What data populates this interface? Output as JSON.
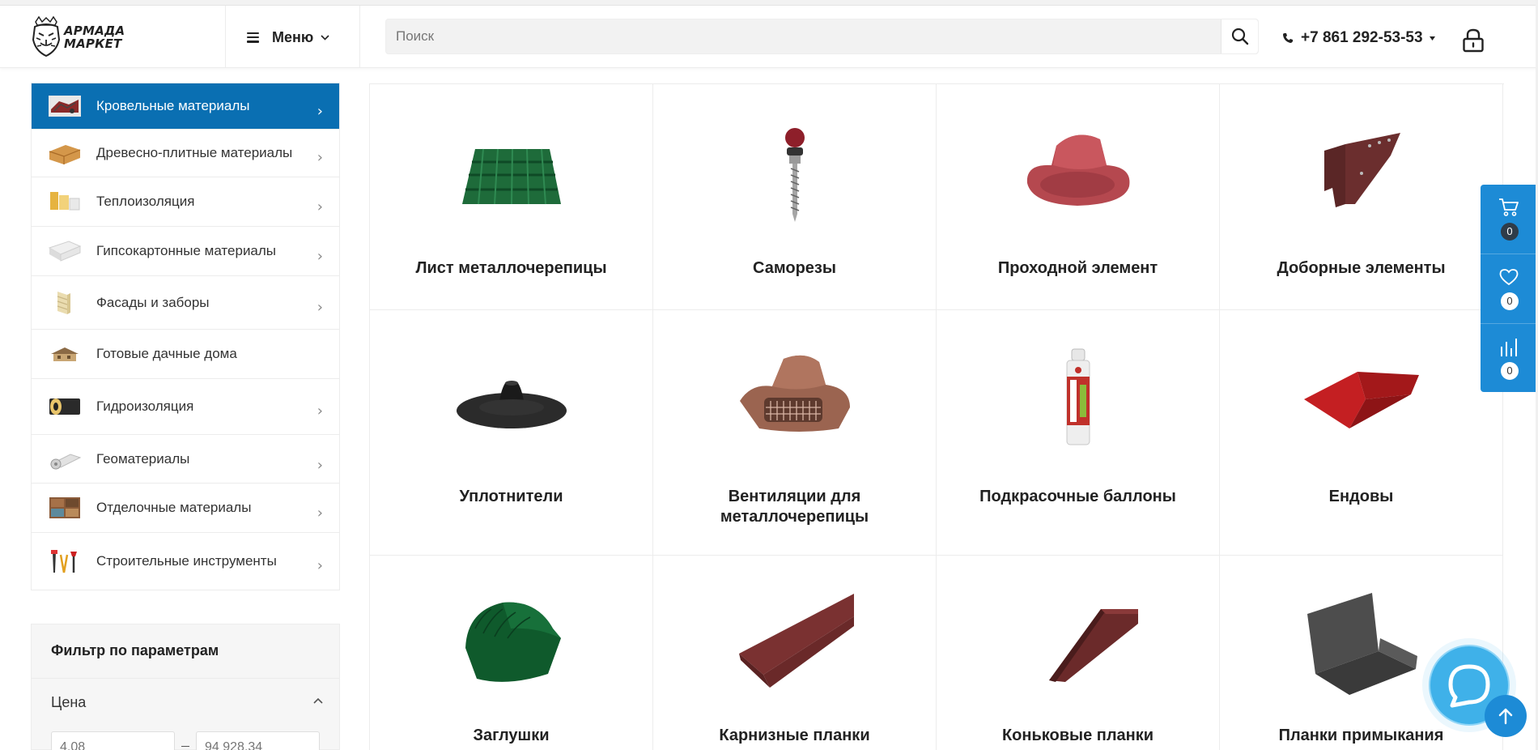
{
  "brand": {
    "logo_line1": "АРМАДА",
    "logo_line2": "МАРКЕТ"
  },
  "header": {
    "menu_label": "Меню",
    "search_placeholder": "Поиск",
    "search_value": "",
    "phone": "+7 861 292-53-53"
  },
  "categories": [
    {
      "label": "Кровельные материалы",
      "has_arrow": true,
      "active": true
    },
    {
      "label": "Древесно-плитные материалы",
      "has_arrow": true
    },
    {
      "label": "Теплоизоляция",
      "has_arrow": true
    },
    {
      "label": "Гипсокартонные материалы",
      "has_arrow": true
    },
    {
      "label": "Фасады и заборы",
      "has_arrow": true
    },
    {
      "label": "Готовые дачные дома",
      "has_arrow": false
    },
    {
      "label": "Гидроизоляция",
      "has_arrow": true
    },
    {
      "label": "Геоматериалы",
      "has_arrow": true
    },
    {
      "label": "Отделочные материалы",
      "has_arrow": true
    },
    {
      "label": "Строительные инструменты",
      "has_arrow": true
    }
  ],
  "filter": {
    "title": "Фильтр по параметрам",
    "price_label": "Цена",
    "price_min_placeholder": "4.08",
    "price_max_placeholder": "94 928.34"
  },
  "products": [
    {
      "name": "Лист металлочерепицы",
      "icon": "metal-tile-image"
    },
    {
      "name": "Саморезы",
      "icon": "screw-image"
    },
    {
      "name": "Проходной элемент",
      "icon": "pass-element-image"
    },
    {
      "name": "Доборные элементы",
      "icon": "additional-element-image"
    },
    {
      "name": "Уплотнители",
      "icon": "seal-image"
    },
    {
      "name": "Вентиляции для металлочерепицы",
      "icon": "ventilation-image"
    },
    {
      "name": "Подкрасочные баллоны",
      "icon": "spray-can-image"
    },
    {
      "name": "Ендовы",
      "icon": "valley-image"
    },
    {
      "name": "Заглушки",
      "icon": "end-cap-image"
    },
    {
      "name": "Карнизные планки",
      "icon": "eaves-strip-image"
    },
    {
      "name": "Коньковые планки",
      "icon": "ridge-strip-image"
    },
    {
      "name": "Планки примыкания",
      "icon": "abutment-strip-image"
    }
  ],
  "widgets": {
    "cart_count": "0",
    "favorites_count": "0",
    "compare_count": "0"
  },
  "colors": {
    "accent": "#0a6fb2",
    "widget": "#1d8bd6",
    "chat": "#3fb1e9"
  }
}
